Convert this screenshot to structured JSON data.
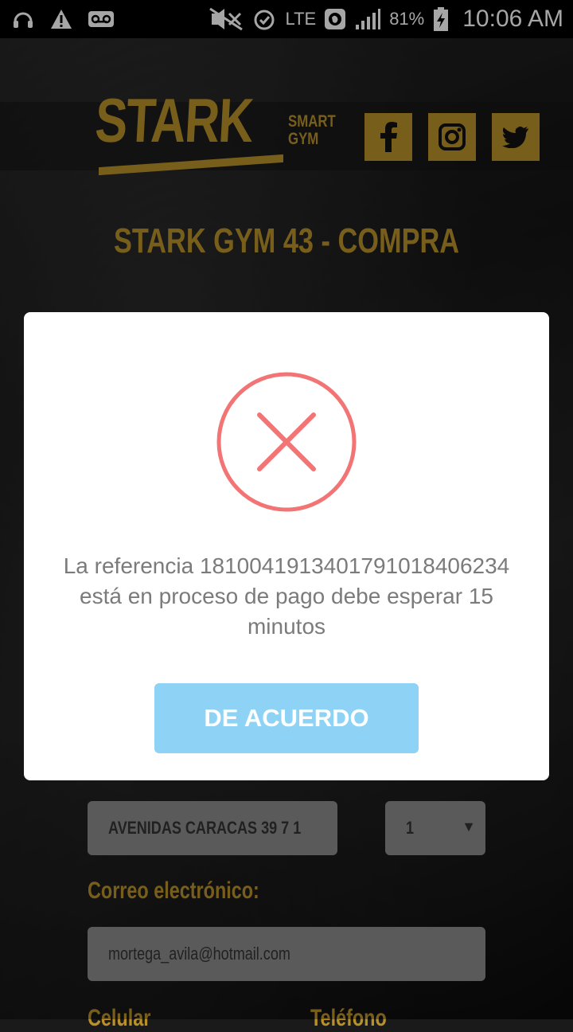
{
  "status_bar": {
    "battery": "81%",
    "network": "LTE",
    "time": "10:06 AM"
  },
  "header": {
    "logo_main": "STARK",
    "logo_sub_line1": "SMART",
    "logo_sub_line2": "GYM",
    "social": [
      "facebook-icon",
      "instagram-icon",
      "twitter-icon"
    ],
    "accent_color": "#b8912a"
  },
  "page": {
    "title": "STARK GYM 43 - COMPRA"
  },
  "form": {
    "address_value": "AVENIDAS CARACAS 39 7 1",
    "quantity_value": "1",
    "email_label": "Correo electrónico:",
    "email_value": "mortega_avila@hotmail.com",
    "cell_label": "Celular",
    "phone_label": "Teléfono"
  },
  "modal": {
    "message": "La referencia 18100419134017910184062​34 está en proceso de pago debe esperar 15 minutos",
    "ok_label": "DE ACUERDO",
    "error_color": "#f27474",
    "button_color": "#8ed3f5"
  }
}
